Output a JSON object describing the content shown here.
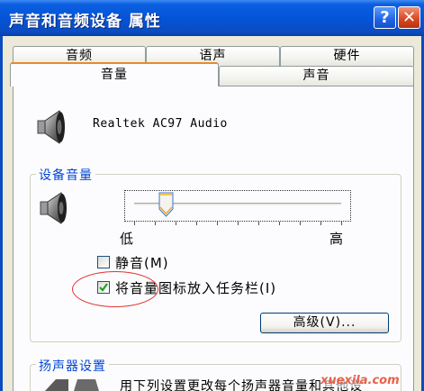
{
  "window": {
    "title": "声音和音频设备 属性",
    "help_label": "?",
    "close_label": "✕"
  },
  "tabs": {
    "row1": [
      {
        "label": "音频"
      },
      {
        "label": "语声"
      },
      {
        "label": "硬件"
      }
    ],
    "row2": [
      {
        "label": "音量",
        "active": true
      },
      {
        "label": "声音",
        "active": false
      }
    ]
  },
  "device": {
    "icon": "speaker-icon",
    "name": "Realtek AC97 Audio"
  },
  "device_volume": {
    "group_label": "设备音量",
    "icon": "speaker-icon",
    "slider_level": 0.15,
    "low_label": "低",
    "high_label": "高",
    "mute_label": "静音(M)",
    "mute_checked": false,
    "taskbar_label": "将音量图标放入任务栏(I)",
    "taskbar_checked": true,
    "advanced_label": "高级(V)..."
  },
  "speaker_settings": {
    "group_label": "扬声器设置",
    "description": "用下列设置更改每个扬声器音量和其他设"
  },
  "watermark": "xuexila.com",
  "colors": {
    "titlebar": "#0a4cc2",
    "group_label": "#0046d5",
    "tab_highlight": "#e68b2c",
    "annotation": "#e0322c",
    "check": "#21a121"
  }
}
